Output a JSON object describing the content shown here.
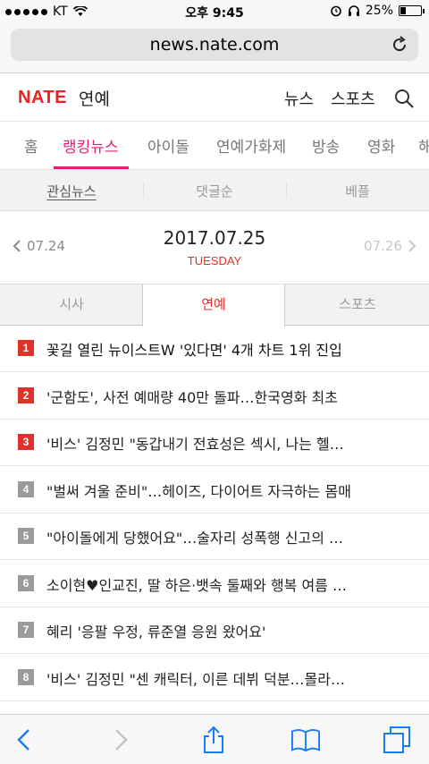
{
  "status_bar": {
    "carrier": "KT",
    "time": "오후 9:45",
    "battery_percent": "25%",
    "battery_level": 0.25
  },
  "browser": {
    "url": "news.nate.com"
  },
  "header": {
    "logo": "NATE",
    "section": "연예",
    "nav": [
      "뉴스",
      "스포츠"
    ]
  },
  "category_tabs": {
    "items": [
      "홈",
      "랭킹뉴스",
      "아이돌",
      "연예가화제",
      "방송",
      "영화",
      "해"
    ],
    "active_index": 1
  },
  "sub_tabs": {
    "items": [
      "관심뉴스",
      "댓글순",
      "베플"
    ],
    "active_index": 0
  },
  "date_nav": {
    "prev": "07.24",
    "current": "2017.07.25",
    "weekday": "TUESDAY",
    "next": "07.26"
  },
  "topic_tabs": {
    "items": [
      "시사",
      "연예",
      "스포츠"
    ],
    "active_index": 1
  },
  "ranking": [
    {
      "rank": "1",
      "title": "꽃길 열린 뉴이스트W '있다면' 4개 차트 1위 진입",
      "badge_color": "#e0312a"
    },
    {
      "rank": "2",
      "title": "'군함도', 사전 예매량 40만 돌파…한국영화 최초",
      "badge_color": "#e0312a"
    },
    {
      "rank": "3",
      "title": "'비스' 김정민 \"동갑내기 전효성은 섹시, 나는 헬…",
      "badge_color": "#e0312a"
    },
    {
      "rank": "4",
      "title": "\"벌써 겨울 준비\"…헤이즈, 다이어트 자극하는 몸매",
      "badge_color": "#9a9a9a"
    },
    {
      "rank": "5",
      "title": "\"아이돌에게 당했어요\"…술자리 성폭행 신고의 …",
      "badge_color": "#9a9a9a"
    },
    {
      "rank": "6",
      "title": "소이현♥인교진, 딸 하은·뱃속 둘째와 행복 여름 …",
      "badge_color": "#9a9a9a"
    },
    {
      "rank": "7",
      "title": "혜리 '응팔 우정, 류준열 응원 왔어요'",
      "badge_color": "#9a9a9a"
    },
    {
      "rank": "8",
      "title": "'비스' 김정민 \"센 캐릭터, 이른 데뷔 덕분…몰라…",
      "badge_color": "#9a9a9a"
    }
  ],
  "toolbar": {
    "icons": [
      "back-icon",
      "forward-icon",
      "share-icon",
      "bookmarks-icon",
      "tabs-icon"
    ]
  },
  "colors": {
    "accent_pink": "#e91e7a",
    "accent_red": "#e0312a",
    "ios_blue": "#1a7cf5"
  }
}
